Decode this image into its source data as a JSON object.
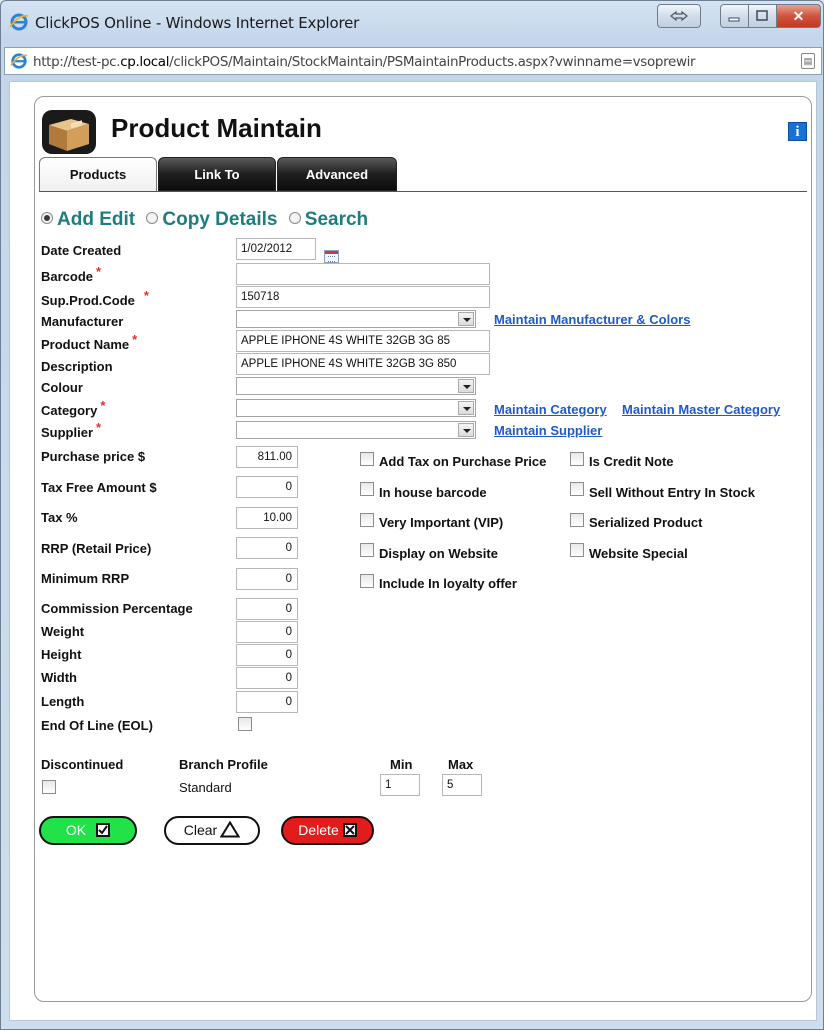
{
  "window": {
    "title": "ClickPOS Online - Windows Internet Explorer",
    "address": "http://test-pc.cp.local/clickPOS/Maintain/StockMaintain/PSMaintainProducts.aspx?vwinname=vsoprewir",
    "address_host_pre": "http://test-pc.",
    "address_host_bold": "cp.local",
    "address_path": "/clickPOS/Maintain/StockMaintain/PSMaintainProducts.aspx?vwinname=vsoprewir"
  },
  "header": {
    "title": "Product Maintain",
    "info_glyph": "i"
  },
  "tabs": [
    {
      "label": "Products",
      "active": true
    },
    {
      "label": "Link To",
      "active": false
    },
    {
      "label": "Advanced",
      "active": false
    }
  ],
  "modes": [
    {
      "label": "Add Edit",
      "selected": true
    },
    {
      "label": "Copy Details",
      "selected": false
    },
    {
      "label": "Search",
      "selected": false
    }
  ],
  "fields": {
    "date_created": {
      "label": "Date Created",
      "value": "1/02/2012"
    },
    "barcode": {
      "label": "Barcode",
      "value": "",
      "required": "*"
    },
    "sup_prod_code": {
      "label": "Sup.Prod.Code",
      "value": "150718",
      "required": "*"
    },
    "manufacturer": {
      "label": "Manufacturer",
      "value": ""
    },
    "product_name": {
      "label": "Product Name",
      "value": "APPLE IPHONE 4S WHITE 32GB 3G 85",
      "required": "*"
    },
    "description": {
      "label": "Description",
      "value": "APPLE IPHONE 4S WHITE 32GB 3G 850"
    },
    "colour": {
      "label": "Colour",
      "value": ""
    },
    "category": {
      "label": "Category",
      "value": "",
      "required": "*"
    },
    "supplier": {
      "label": "Supplier",
      "value": "",
      "required": "*"
    },
    "purchase_price": {
      "label": "Purchase price $",
      "value": "811.00"
    },
    "tax_free_amount": {
      "label": "Tax Free Amount $",
      "value": "0"
    },
    "tax": {
      "label": "Tax %",
      "value": "10.00"
    },
    "rrp": {
      "label": "RRP (Retail Price)",
      "value": "0"
    },
    "minimum_rrp": {
      "label": "Minimum RRP",
      "value": "0"
    },
    "commission": {
      "label": "Commission Percentage",
      "value": "0"
    },
    "weight": {
      "label": "Weight",
      "value": "0"
    },
    "height": {
      "label": "Height",
      "value": "0"
    },
    "width": {
      "label": "Width",
      "value": "0"
    },
    "length": {
      "label": "Length",
      "value": "0"
    },
    "eol": {
      "label": "End Of Line (EOL)"
    }
  },
  "links": {
    "manufacturer": "Maintain Manufacturer & Colors",
    "category": "Maintain Category",
    "master_category": "Maintain Master Category",
    "supplier": "Maintain Supplier"
  },
  "checkboxes": {
    "add_tax": "Add Tax on Purchase Price",
    "credit_note": "Is Credit Note",
    "in_house_barcode": "In house barcode",
    "sell_without_entry": "Sell Without Entry In Stock",
    "vip": "Very Important (VIP)",
    "serialized": "Serialized Product",
    "display_website": "Display on Website",
    "website_special": "Website Special",
    "loyalty": "Include In loyalty offer"
  },
  "branch": {
    "headers": {
      "discontinued": "Discontinued",
      "profile": "Branch Profile",
      "min": "Min",
      "max": "Max"
    },
    "row": {
      "profile": "Standard",
      "min": "1",
      "max": "5"
    }
  },
  "buttons": {
    "ok": "OK",
    "clear": "Clear",
    "delete": "Delete"
  },
  "colors": {
    "ok": "#22e24a",
    "delete": "#e41b1b",
    "mode": "#1f7d7d",
    "link": "#1f5bc6",
    "required": "#e23030"
  }
}
